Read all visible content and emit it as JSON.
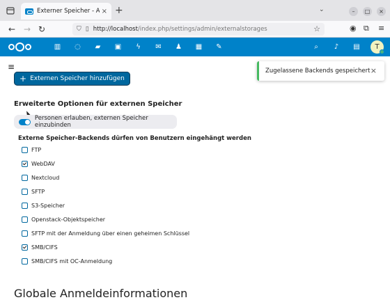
{
  "browser": {
    "tab_title": "Externer Speicher - Admin",
    "tab_close": "×",
    "new_tab": "+",
    "url_base": "http://localhost",
    "url_path": "/index.php/settings/admin/externalstorages",
    "window_controls": [
      "–",
      "□",
      "×"
    ]
  },
  "toast": {
    "text": "Zugelassene Backends gespeichert",
    "close": "×"
  },
  "main": {
    "add_button_label": "Externen Speicher hinzufügen",
    "advanced_title": "Erweiterte Optionen für externen Speicher",
    "allow_toggle_label": "Personen erlauben, externen Speicher einzubinden",
    "allow_toggle_on": true,
    "backends_heading": "Externe Speicher-Backends dürfen von Benutzern eingehängt werden",
    "backends": [
      {
        "label": "FTP",
        "checked": false
      },
      {
        "label": "WebDAV",
        "checked": true
      },
      {
        "label": "Nextcloud",
        "checked": false
      },
      {
        "label": "SFTP",
        "checked": false
      },
      {
        "label": "S3-Speicher",
        "checked": false
      },
      {
        "label": "Openstack-Objektspeicher",
        "checked": false
      },
      {
        "label": "SFTP mit der Anmeldung über einen geheimen Schlüssel",
        "checked": false
      },
      {
        "label": "SMB/CIFS",
        "checked": true
      },
      {
        "label": "SMB/CIFS mit OC-Anmeldung",
        "checked": false
      }
    ],
    "global_title": "Globale Anmeldeinformationen"
  },
  "header": {
    "avatar_initial": "T",
    "accent": "#0082c9",
    "button_color": "#00679e",
    "success_color": "#46ba61",
    "app_icons": [
      "dashboard-icon",
      "activity-icon",
      "files-icon",
      "photos-icon",
      "flow-icon",
      "mail-icon",
      "contacts-icon",
      "calendar-icon",
      "notes-icon"
    ]
  }
}
